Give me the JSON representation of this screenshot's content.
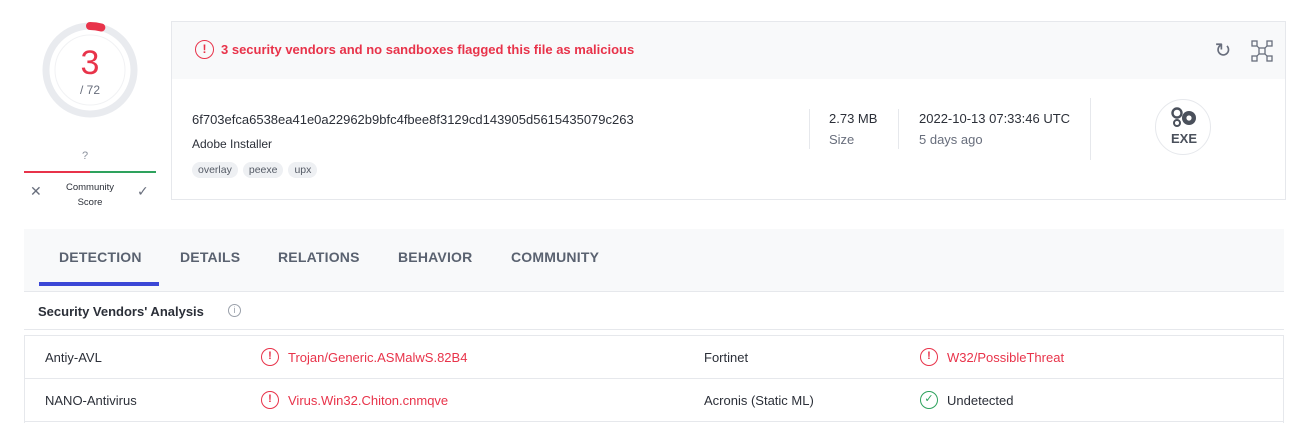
{
  "score": {
    "detections": "3",
    "total": "/ 72",
    "ratio": 0.0417,
    "color": "#e8334a"
  },
  "community": {
    "unknown_mark": "?",
    "label_line1": "Community",
    "label_line2": "Score",
    "negative_icon": "x-icon",
    "positive_icon": "check-icon"
  },
  "alert": {
    "icon": "alert-circle-icon",
    "text": "3 security vendors and no sandboxes flagged this file as malicious"
  },
  "file": {
    "hash": "6f703efca6538ea41e0a22962b9bfc4fbee8f3129cd143905d5615435079c263",
    "name": "Adobe Installer",
    "tags": [
      "overlay",
      "peexe",
      "upx"
    ],
    "size_value": "2.73 MB",
    "size_label": "Size",
    "date_value": "2022-10-13 07:33:46 UTC",
    "date_relative": "5 days ago",
    "type_label": "EXE"
  },
  "tabs": [
    "DETECTION",
    "DETAILS",
    "RELATIONS",
    "BEHAVIOR",
    "COMMUNITY"
  ],
  "active_tab": "DETECTION",
  "section": {
    "title": "Security Vendors' Analysis"
  },
  "vendors": [
    {
      "left_name": "Antiy-AVL",
      "left_result": "Trojan/Generic.ASMalwS.82B4",
      "left_status": "malicious",
      "right_name": "Fortinet",
      "right_result": "W32/PossibleThreat",
      "right_status": "malicious"
    },
    {
      "left_name": "NANO-Antivirus",
      "left_result": "Virus.Win32.Chiton.cnmqve",
      "left_status": "malicious",
      "right_name": "Acronis (Static ML)",
      "right_result": "Undetected",
      "right_status": "undetected"
    }
  ],
  "colors": {
    "malicious": "#e8334a",
    "clean": "#2ea25d",
    "accent": "#3b47d6"
  }
}
